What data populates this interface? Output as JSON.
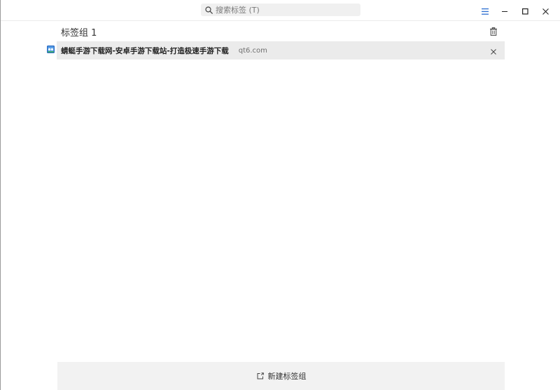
{
  "search": {
    "placeholder": "搜索标签 (T)"
  },
  "window_controls": {
    "menu_icon": "menu-icon",
    "minimize_icon": "minimize-icon",
    "maximize_icon": "maximize-icon",
    "close_icon": "close-icon"
  },
  "groups": [
    {
      "title": "标签组 1",
      "tabs": [
        {
          "title": "蜻蜓手游下载网-安卓手游下载站-打造极速手游下载",
          "domain": "qt6.com"
        }
      ]
    }
  ],
  "footer": {
    "new_group_label": "新建标签组"
  },
  "colors": {
    "accent": "#2f6fd1",
    "row_bg": "#ebebeb",
    "search_bg": "#f0f0f0",
    "footer_bg": "#f2f2f2"
  }
}
